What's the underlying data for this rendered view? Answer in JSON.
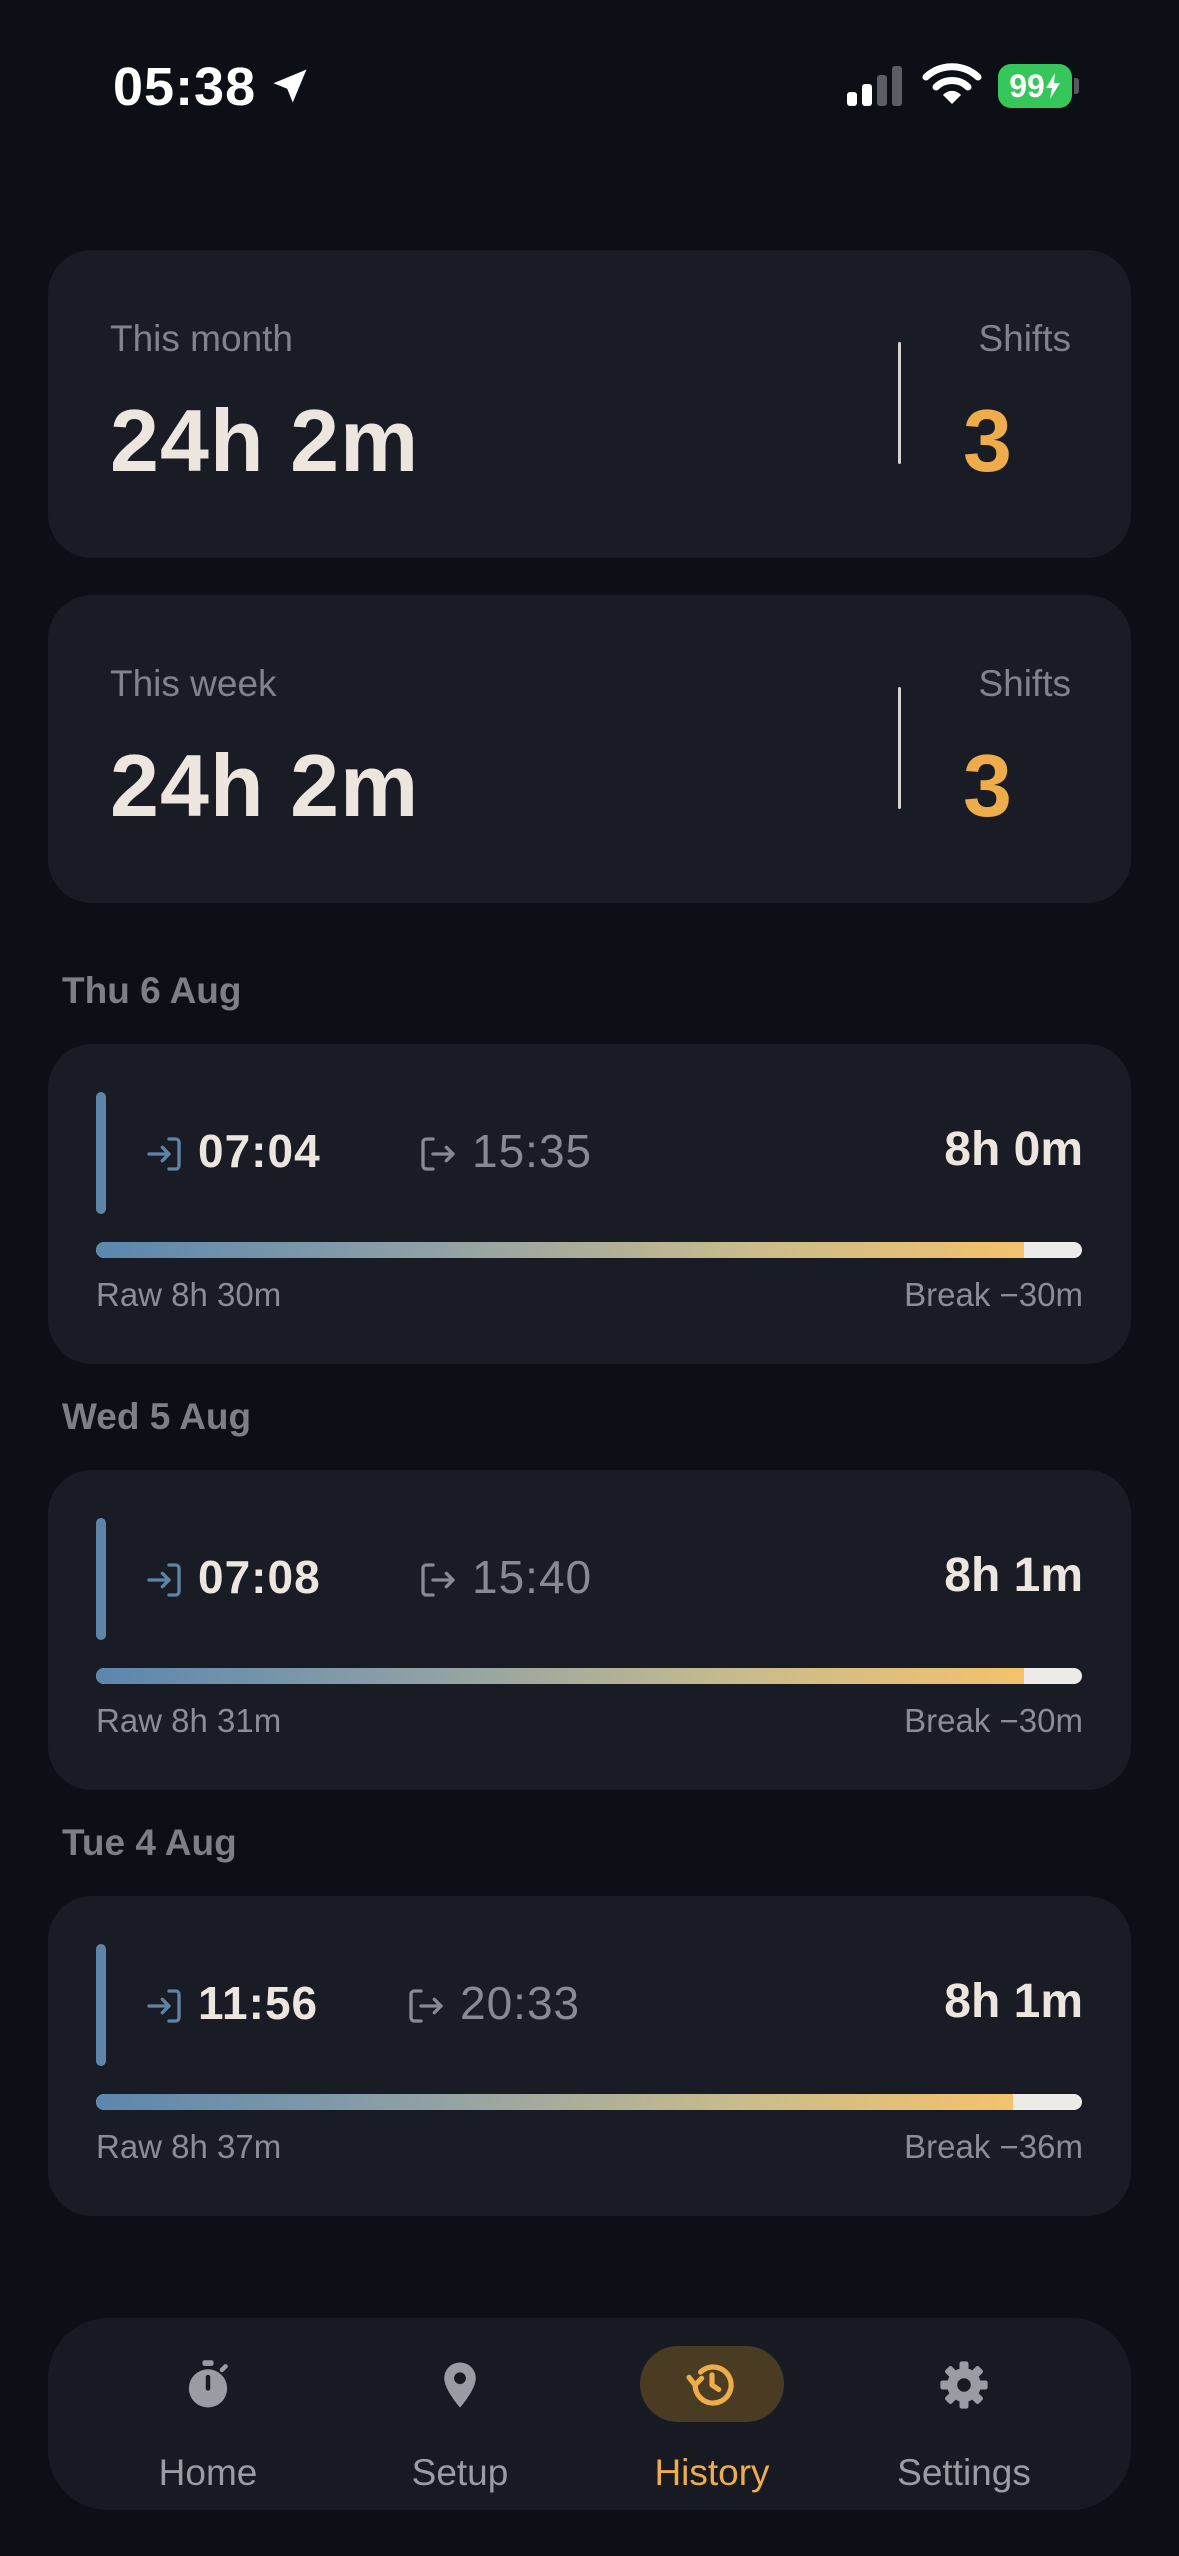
{
  "status_bar": {
    "time": "05:38",
    "battery": "99"
  },
  "summary": [
    {
      "label": "This month",
      "value": "24h 2m",
      "shifts_label": "Shifts",
      "shifts": "3"
    },
    {
      "label": "This week",
      "value": "24h 2m",
      "shifts_label": "Shifts",
      "shifts": "3"
    }
  ],
  "days": [
    {
      "heading": "Thu 6 Aug",
      "in": "07:04",
      "out": "15:35",
      "net": "8h 0m",
      "raw": "Raw 8h 30m",
      "break": "Break −30m",
      "work_fraction": 0.941
    },
    {
      "heading": "Wed 5 Aug",
      "in": "07:08",
      "out": "15:40",
      "net": "8h 1m",
      "raw": "Raw 8h 31m",
      "break": "Break −30m",
      "work_fraction": 0.941
    },
    {
      "heading": "Tue 4 Aug",
      "in": "11:56",
      "out": "20:33",
      "net": "8h 1m",
      "raw": "Raw 8h 37m",
      "break": "Break −36m",
      "work_fraction": 0.93
    }
  ],
  "nav": [
    {
      "label": "Home",
      "icon": "stopwatch-icon",
      "active": false
    },
    {
      "label": "Setup",
      "icon": "map-pin-icon",
      "active": false
    },
    {
      "label": "History",
      "icon": "history-icon",
      "active": true
    },
    {
      "label": "Settings",
      "icon": "gear-icon",
      "active": false
    }
  ],
  "colors": {
    "accent": "#efac4b",
    "background": "#0c0f15",
    "card": "#191c24",
    "clock_in": "#5e85a8"
  }
}
